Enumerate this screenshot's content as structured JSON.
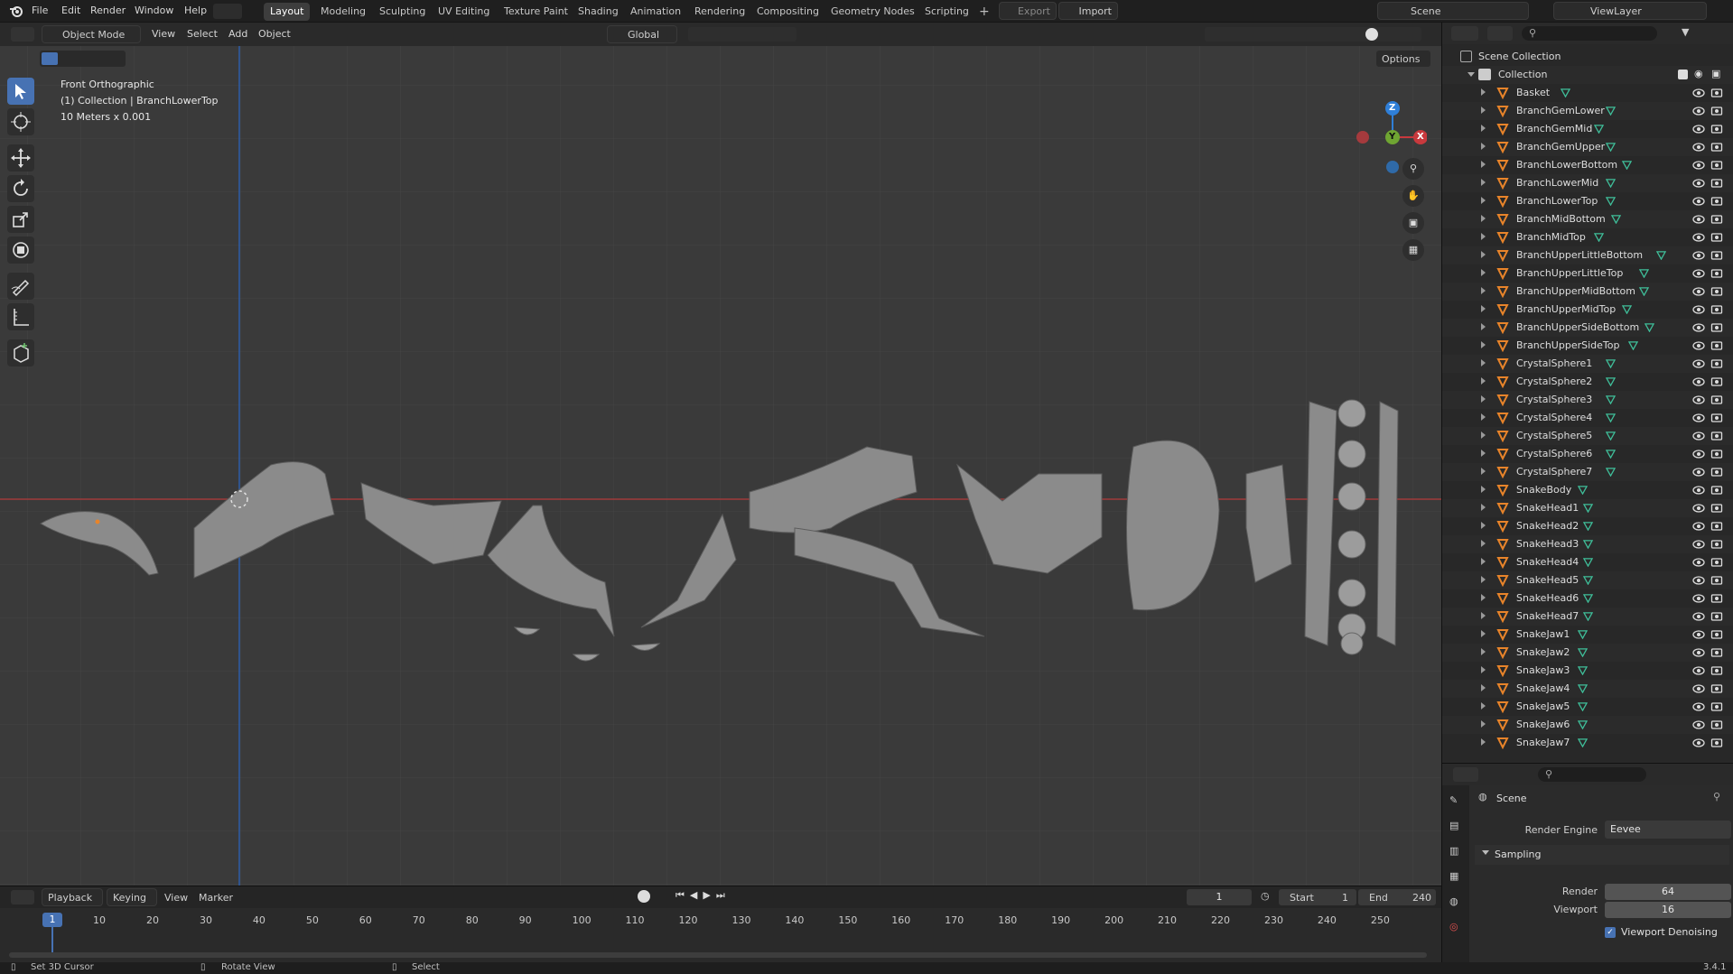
{
  "menu": {
    "file": "File",
    "edit": "Edit",
    "render": "Render",
    "window": "Window",
    "help": "Help"
  },
  "workspaces": [
    "Layout",
    "Modeling",
    "Sculpting",
    "UV Editing",
    "Texture Paint",
    "Shading",
    "Animation",
    "Rendering",
    "Compositing",
    "Geometry Nodes",
    "Scripting"
  ],
  "top_right": {
    "export": "Export",
    "import": "Import",
    "scene": "Scene",
    "viewlayer": "ViewLayer"
  },
  "viewport_header": {
    "mode": "Object Mode",
    "view": "View",
    "select": "Select",
    "add": "Add",
    "object": "Object",
    "orientation": "Global",
    "options": "Options"
  },
  "viewport_info": {
    "line1": "Front Orthographic",
    "line2": "(1) Collection | BranchLowerTop",
    "line3": "10 Meters x 0.001"
  },
  "gizmo": {
    "z": "Z",
    "y": "Y",
    "x": "X"
  },
  "outliner": {
    "scene_collection": "Scene Collection",
    "collection": "Collection",
    "objects": [
      "Basket",
      "BranchGemLower",
      "BranchGemMid",
      "BranchGemUpper",
      "BranchLowerBottom",
      "BranchLowerMid",
      "BranchLowerTop",
      "BranchMidBottom",
      "BranchMidTop",
      "BranchUpperLittleBottom",
      "BranchUpperLittleTop",
      "BranchUpperMidBottom",
      "BranchUpperMidTop",
      "BranchUpperSideBottom",
      "BranchUpperSideTop",
      "CrystalSphere1",
      "CrystalSphere2",
      "CrystalSphere3",
      "CrystalSphere4",
      "CrystalSphere5",
      "CrystalSphere6",
      "CrystalSphere7",
      "SnakeBody",
      "SnakeHead1",
      "SnakeHead2",
      "SnakeHead3",
      "SnakeHead4",
      "SnakeHead5",
      "SnakeHead6",
      "SnakeHead7",
      "SnakeJaw1",
      "SnakeJaw2",
      "SnakeJaw3",
      "SnakeJaw4",
      "SnakeJaw5",
      "SnakeJaw6",
      "SnakeJaw7"
    ]
  },
  "properties": {
    "scene": "Scene",
    "render_engine_label": "Render Engine",
    "render_engine": "Eevee",
    "sampling": "Sampling",
    "render_label": "Render",
    "render_value": "64",
    "viewport_label": "Viewport",
    "viewport_value": "16",
    "denoise": "Viewport Denoising"
  },
  "timeline": {
    "playback": "Playback",
    "keying": "Keying",
    "view": "View",
    "marker": "Marker",
    "current": "1",
    "start_label": "Start",
    "start": "1",
    "end_label": "End",
    "end": "240",
    "ticks": [
      "10",
      "20",
      "30",
      "40",
      "50",
      "60",
      "70",
      "80",
      "90",
      "100",
      "110",
      "120",
      "130",
      "140",
      "150",
      "160",
      "170",
      "180",
      "190",
      "200",
      "210",
      "220",
      "230",
      "240",
      "250"
    ],
    "frame_marker": "1"
  },
  "status": {
    "set_cursor": "Set 3D Cursor",
    "rotate": "Rotate View",
    "select": "Select",
    "version": "3.4.1"
  },
  "colors": {
    "accent": "#4772b3",
    "object_orange": "#e8842a",
    "mesh_green": "#3fbf9a",
    "x_axis": "#c8393d",
    "y_axis": "#6fa532",
    "z_axis": "#2f7fd8"
  }
}
